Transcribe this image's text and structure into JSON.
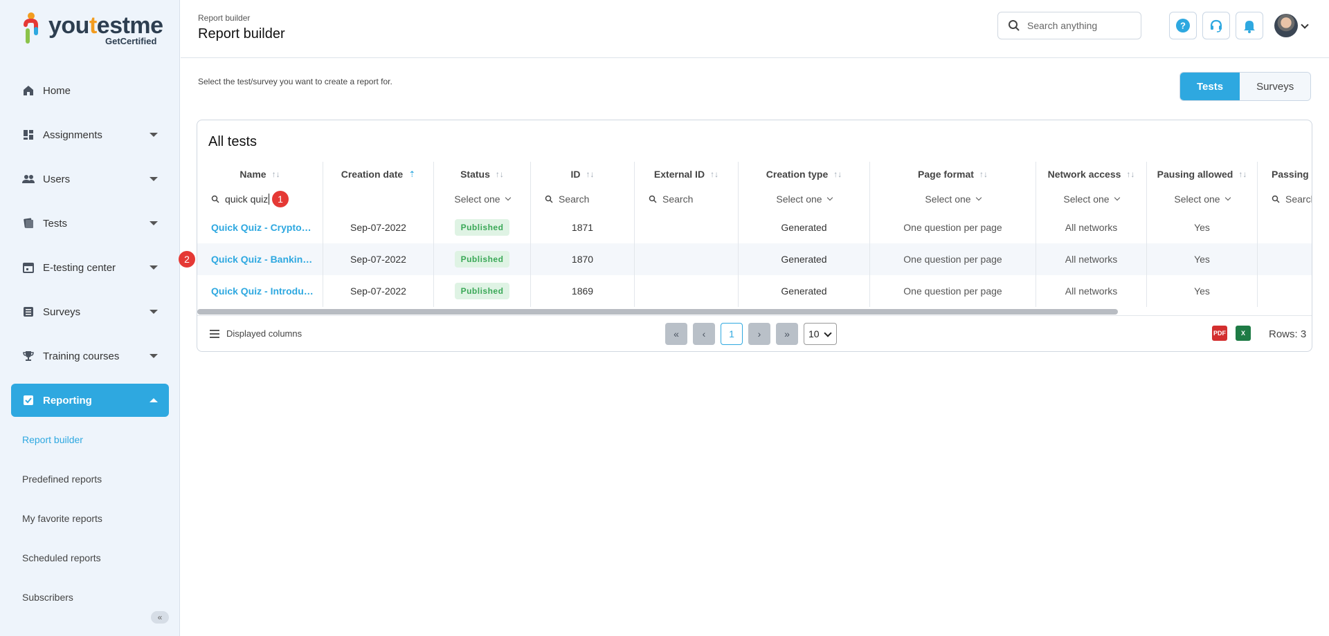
{
  "brand": {
    "name_a": "you",
    "name_b": "t",
    "name_c": "estme",
    "tagline": "GetCertified",
    "accent": "#2ea8e0"
  },
  "sidebar": {
    "items": [
      {
        "label": "Home",
        "icon": "home-icon"
      },
      {
        "label": "Assignments",
        "icon": "dashboard-icon"
      },
      {
        "label": "Users",
        "icon": "users-icon"
      },
      {
        "label": "Tests",
        "icon": "tests-icon"
      },
      {
        "label": "E-testing center",
        "icon": "calendar-icon"
      },
      {
        "label": "Surveys",
        "icon": "list-icon"
      },
      {
        "label": "Training courses",
        "icon": "trophy-icon"
      },
      {
        "label": "Reporting",
        "icon": "report-icon"
      }
    ],
    "sub_items": [
      "Report builder",
      "Predefined reports",
      "My favorite reports",
      "Scheduled reports",
      "Subscribers"
    ]
  },
  "header": {
    "breadcrumb": "Report builder",
    "title": "Report builder",
    "search_placeholder": "Search anything"
  },
  "main": {
    "instruction": "Select the test/survey you want to create a report for.",
    "toggle": {
      "tests": "Tests",
      "surveys": "Surveys"
    },
    "card_title": "All tests",
    "columns": [
      "Name",
      "Creation date",
      "Status",
      "ID",
      "External ID",
      "Creation type",
      "Page format",
      "Network access",
      "Pausing allowed",
      "Passing r"
    ],
    "filters": {
      "name_value": "quick quiz",
      "select_one": "Select one",
      "search": "Search",
      "passing_search": "Search"
    },
    "rows": [
      {
        "name": "Quick Quiz - Crypto…",
        "date": "Sep-07-2022",
        "status": "Published",
        "id": "1871",
        "external_id": "",
        "creation_type": "Generated",
        "page_format": "One question per page",
        "network": "All networks",
        "pausing": "Yes"
      },
      {
        "name": "Quick Quiz - Bankin…",
        "date": "Sep-07-2022",
        "status": "Published",
        "id": "1870",
        "external_id": "",
        "creation_type": "Generated",
        "page_format": "One question per page",
        "network": "All networks",
        "pausing": "Yes"
      },
      {
        "name": "Quick Quiz - Introdu…",
        "date": "Sep-07-2022",
        "status": "Published",
        "id": "1869",
        "external_id": "",
        "creation_type": "Generated",
        "page_format": "One question per page",
        "network": "All networks",
        "pausing": "Yes"
      }
    ],
    "markers": [
      "1",
      "2"
    ],
    "footer": {
      "displayed_columns": "Displayed columns",
      "current_page": "1",
      "per_page": "10",
      "rows_label": "Rows: 3",
      "pdf_label": "PDF",
      "xls_label": "X"
    }
  }
}
